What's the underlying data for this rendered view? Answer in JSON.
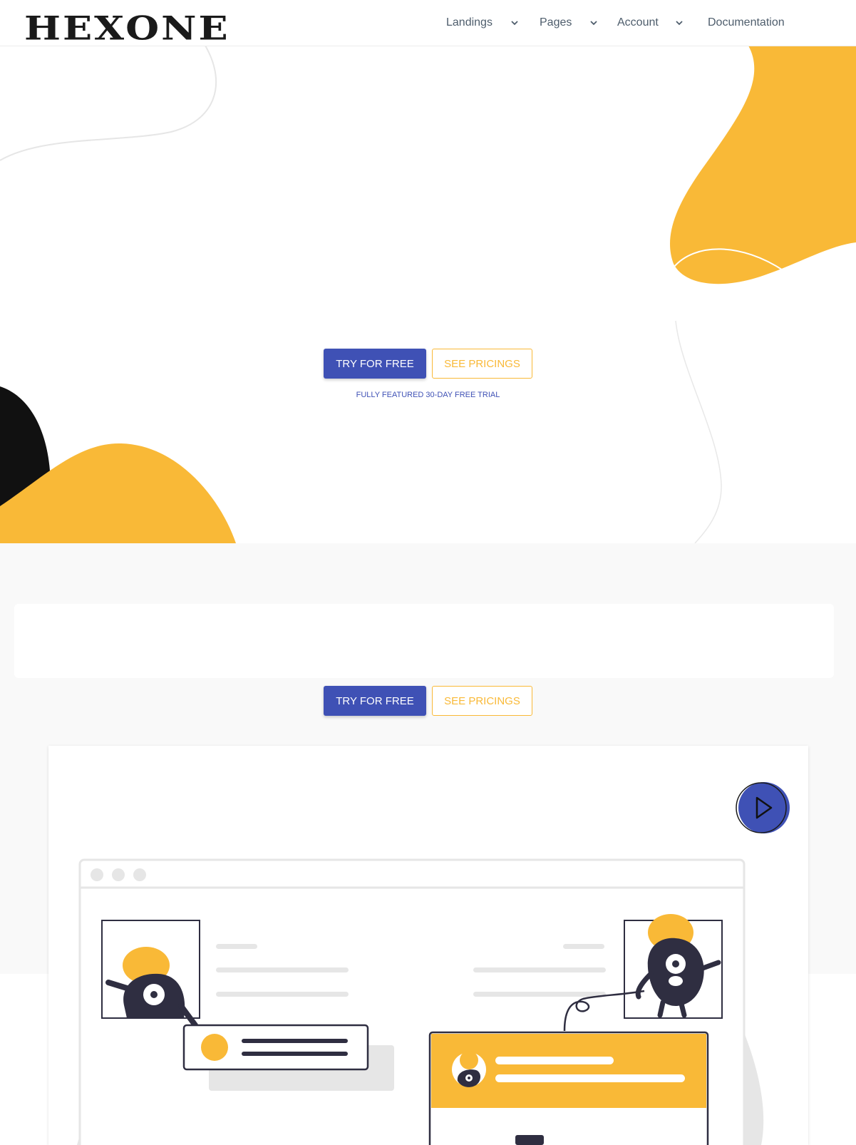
{
  "header": {
    "logo": "HEXONE",
    "nav": [
      {
        "label": "Landings",
        "has_dropdown": true
      },
      {
        "label": "Pages",
        "has_dropdown": true
      },
      {
        "label": "Account",
        "has_dropdown": true
      },
      {
        "label": "Documentation",
        "has_dropdown": false
      }
    ]
  },
  "hero": {
    "primary_button": "TRY FOR FREE",
    "secondary_button": "SEE PRICINGS",
    "trial_note": "FULLY FEATURED 30-DAY FREE TRIAL"
  },
  "section2": {
    "primary_button": "TRY FOR FREE",
    "secondary_button": "SEE PRICINGS"
  },
  "video": {
    "play_icon": "play-icon"
  },
  "colors": {
    "primary": "#3f51b5",
    "accent": "#f9b937",
    "dark": "#2f2e41",
    "text": "#4e5d6c"
  }
}
